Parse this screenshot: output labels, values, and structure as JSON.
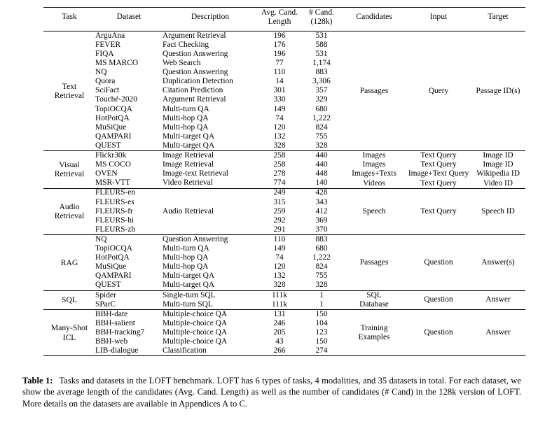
{
  "table": {
    "columns": [
      {
        "key": "task",
        "label": "Task"
      },
      {
        "key": "dataset",
        "label": "Dataset"
      },
      {
        "key": "description",
        "label": "Description"
      },
      {
        "key": "avg_len",
        "label": "Avg. Cand.",
        "label2": "Length"
      },
      {
        "key": "num_cand",
        "label": "# Cand.",
        "label2": "(128k)"
      },
      {
        "key": "candidates",
        "label": "Candidates"
      },
      {
        "key": "input",
        "label": "Input"
      },
      {
        "key": "target",
        "label": "Target"
      }
    ],
    "sections": [
      {
        "task": "Text\nRetrieval",
        "task_line1": "Text",
        "task_line2": "Retrieval",
        "candidates": "Passages",
        "input": "Query",
        "target": "Passage ID(s)",
        "rows": [
          {
            "dataset": "ArguAna",
            "description": "Argument Retrieval",
            "avg_len": "196",
            "num_cand": "531"
          },
          {
            "dataset": "FEVER",
            "description": "Fact Checking",
            "avg_len": "176",
            "num_cand": "588"
          },
          {
            "dataset": "FIQA",
            "description": "Question Answering",
            "avg_len": "196",
            "num_cand": "531"
          },
          {
            "dataset": "MS MARCO",
            "description": "Web Search",
            "avg_len": "77",
            "num_cand": "1,174"
          },
          {
            "dataset": "NQ",
            "description": "Question Answering",
            "avg_len": "110",
            "num_cand": "883"
          },
          {
            "dataset": "Quora",
            "description": "Duplication Detection",
            "avg_len": "14",
            "num_cand": "3,306"
          },
          {
            "dataset": "SciFact",
            "description": "Citation Prediction",
            "avg_len": "301",
            "num_cand": "357"
          },
          {
            "dataset": "Touché-2020",
            "description": "Argument Retrieval",
            "avg_len": "330",
            "num_cand": "329"
          },
          {
            "dataset": "TopiOCQA",
            "description": "Multi-turn QA",
            "avg_len": "149",
            "num_cand": "680"
          },
          {
            "dataset": "HotPotQA",
            "description": "Multi-hop QA",
            "avg_len": "74",
            "num_cand": "1,222"
          },
          {
            "dataset": "MuSiQue",
            "description": "Multi-hop QA",
            "avg_len": "120",
            "num_cand": "824"
          },
          {
            "dataset": "QAMPARI",
            "description": "Multi-target QA",
            "avg_len": "132",
            "num_cand": "755"
          },
          {
            "dataset": "QUEST",
            "description": "Multi-target QA",
            "avg_len": "328",
            "num_cand": "328"
          }
        ]
      },
      {
        "task_line1": "Visual",
        "task_line2": "Retrieval",
        "per_row_right": true,
        "rows": [
          {
            "dataset": "Flickr30k",
            "description": "Image Retrieval",
            "avg_len": "258",
            "num_cand": "440",
            "candidates": "Images",
            "input": "Text Query",
            "target": "Image ID"
          },
          {
            "dataset": "MS COCO",
            "description": "Image Retrieval",
            "avg_len": "258",
            "num_cand": "440",
            "candidates": "Images",
            "input": "Text Query",
            "target": "Image ID"
          },
          {
            "dataset": "OVEN",
            "description": "Image-text Retrieval",
            "avg_len": "278",
            "num_cand": "448",
            "candidates": "Images+Texts",
            "input": "Image+Text Query",
            "target": "Wikipedia ID"
          },
          {
            "dataset": "MSR-VTT",
            "description": "Video Retrieval",
            "avg_len": "774",
            "num_cand": "140",
            "candidates": "Videos",
            "input": "Text Query",
            "target": "Video ID"
          }
        ]
      },
      {
        "task_line1": "Audio",
        "task_line2": "Retrieval",
        "description_merged": "Audio Retrieval",
        "candidates": "Speech",
        "input": "Text Query",
        "target": "Speech ID",
        "rows": [
          {
            "dataset": "FLEURS-en",
            "avg_len": "249",
            "num_cand": "428"
          },
          {
            "dataset": "FLEURS-es",
            "avg_len": "315",
            "num_cand": "343"
          },
          {
            "dataset": "FLEURS-fr",
            "avg_len": "259",
            "num_cand": "412"
          },
          {
            "dataset": "FLEURS-hi",
            "avg_len": "292",
            "num_cand": "369"
          },
          {
            "dataset": "FLEURS-zh",
            "avg_len": "291",
            "num_cand": "370"
          }
        ]
      },
      {
        "task_line1": "RAG",
        "task_line2": "",
        "candidates": "Passages",
        "input": "Question",
        "target": "Answer(s)",
        "rows": [
          {
            "dataset": "NQ",
            "description": "Question Answering",
            "avg_len": "110",
            "num_cand": "883"
          },
          {
            "dataset": "TopiOCQA",
            "description": "Multi-turn QA",
            "avg_len": "149",
            "num_cand": "680"
          },
          {
            "dataset": "HotPotQA",
            "description": "Multi-hop QA",
            "avg_len": "74",
            "num_cand": "1,222"
          },
          {
            "dataset": "MuSiQue",
            "description": "Multi-hop QA",
            "avg_len": "120",
            "num_cand": "824"
          },
          {
            "dataset": "QAMPARI",
            "description": "Multi-target QA",
            "avg_len": "132",
            "num_cand": "755"
          },
          {
            "dataset": "QUEST",
            "description": "Multi-target QA",
            "avg_len": "328",
            "num_cand": "328"
          }
        ]
      },
      {
        "task_line1": "SQL",
        "task_line2": "",
        "candidates_line1": "SQL",
        "candidates_line2": "Database",
        "input": "Question",
        "target": "Answer",
        "rows": [
          {
            "dataset": "Spider",
            "description": "Single-turn SQL",
            "avg_len": "111k",
            "num_cand": "1"
          },
          {
            "dataset": "SParC",
            "description": "Multi-turn SQL",
            "avg_len": "111k",
            "num_cand": "1"
          }
        ]
      },
      {
        "task_line1": "Many-Shot",
        "task_line2": "ICL",
        "candidates_line1": "Training",
        "candidates_line2": "Examples",
        "input": "Question",
        "target": "Answer",
        "rows": [
          {
            "dataset": "BBH-date",
            "description": "Multiple-choice QA",
            "avg_len": "131",
            "num_cand": "150"
          },
          {
            "dataset": "BBH-salient",
            "description": "Multiple-choice QA",
            "avg_len": "246",
            "num_cand": "104"
          },
          {
            "dataset": "BBH-tracking7",
            "description": "Multiple-choice QA",
            "avg_len": "205",
            "num_cand": "123"
          },
          {
            "dataset": "BBH-web",
            "description": "Multiple-choice QA",
            "avg_len": "43",
            "num_cand": "150"
          },
          {
            "dataset": "LIB-dialogue",
            "description": "Classification",
            "avg_len": "266",
            "num_cand": "274"
          }
        ]
      }
    ]
  },
  "caption": {
    "label": "Table 1:",
    "text": "Tasks and datasets in the LOFT benchmark. LOFT has 6 types of tasks, 4 modalities, and 35 datasets in total. For each dataset, we show the average length of the candidates (Avg. Cand. Length) as well as the number of candidates (# Cand) in the 128k version of LOFT. More details on the datasets are available in Appendices A to C."
  }
}
